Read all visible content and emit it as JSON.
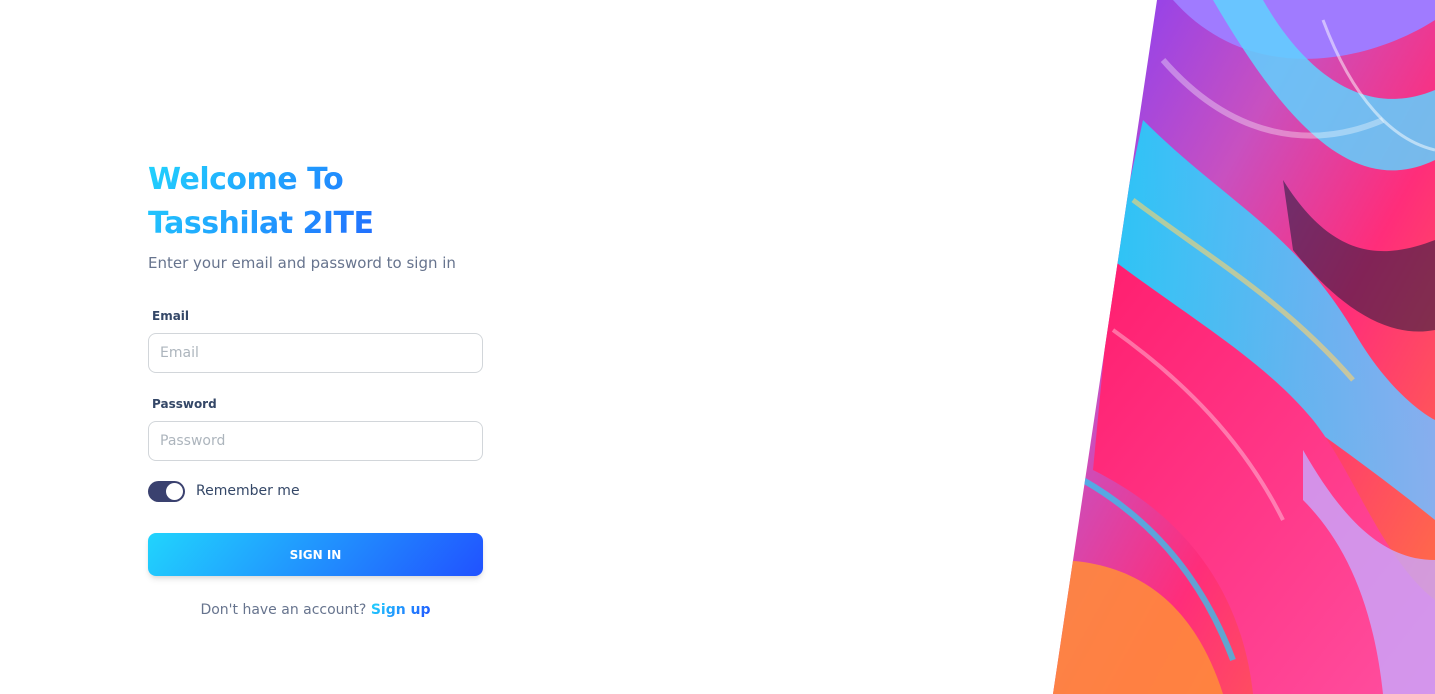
{
  "login": {
    "title": "Welcome To Tasshilat 2ITE",
    "subtitle": "Enter your email and password to sign in",
    "email_label": "Email",
    "email_placeholder": "Email",
    "email_value": "",
    "password_label": "Password",
    "password_placeholder": "Password",
    "password_value": "",
    "remember_label": "Remember me",
    "remember_checked": true,
    "signin_label": "SIGN IN",
    "signup_prompt": "Don't have an account?",
    "signup_link": "Sign up"
  },
  "theme": {
    "gradient_start": "#21d4fd",
    "gradient_end": "#2152ff",
    "toggle_color": "#3a416f"
  },
  "hero": {
    "description_icon": "abstract-colorful-swirl-artwork"
  }
}
